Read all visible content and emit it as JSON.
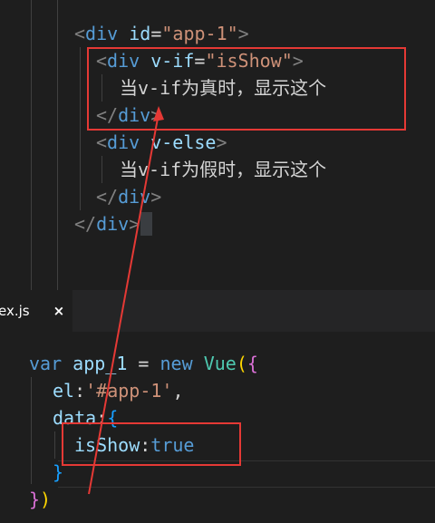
{
  "template_code": {
    "line1": {
      "open": "<",
      "tag": "div",
      "attr": "id",
      "eq": "=",
      "value": "\"app-1\"",
      "close": ">"
    },
    "line2": {
      "open": "<",
      "tag": "div",
      "attr": "v-if",
      "eq": "=",
      "value": "\"isShow\"",
      "close": ">"
    },
    "line3": {
      "text": "当v-if为真时，显示这个"
    },
    "line4": {
      "open": "</",
      "tag": "div",
      "close": ">"
    },
    "line5": {
      "open": "<",
      "tag": "div",
      "attr": "v-else",
      "close": ">"
    },
    "line6": {
      "text": "当v-if为假时，显示这个"
    },
    "line7": {
      "open": "</",
      "tag": "div",
      "close": ">"
    },
    "line8": {
      "open": "</",
      "tag": "div",
      "close": ">"
    }
  },
  "tab": {
    "label": "ex.js",
    "close_glyph": "×"
  },
  "script_code": {
    "line1": {
      "kw_var": "var",
      "name": "app_1",
      "eq": " = ",
      "kw_new": "new",
      "cls": "Vue",
      "paren": "(",
      "brace": "{"
    },
    "line2": {
      "key": "el",
      "colon": ":",
      "value": "'#app-1'",
      "comma": ","
    },
    "line3": {
      "key": "data",
      "colon": ":",
      "brace": "{"
    },
    "line4": {
      "key": "isShow",
      "colon": ":",
      "value": "true"
    },
    "line5": {
      "brace": "}"
    },
    "line6": {
      "brace": "}",
      "paren": ")"
    }
  },
  "colors": {
    "annotation": "#e53935",
    "background": "#1e1e1e",
    "tag": "#569cd6",
    "attribute": "#9cdcfe",
    "string": "#ce9178"
  }
}
